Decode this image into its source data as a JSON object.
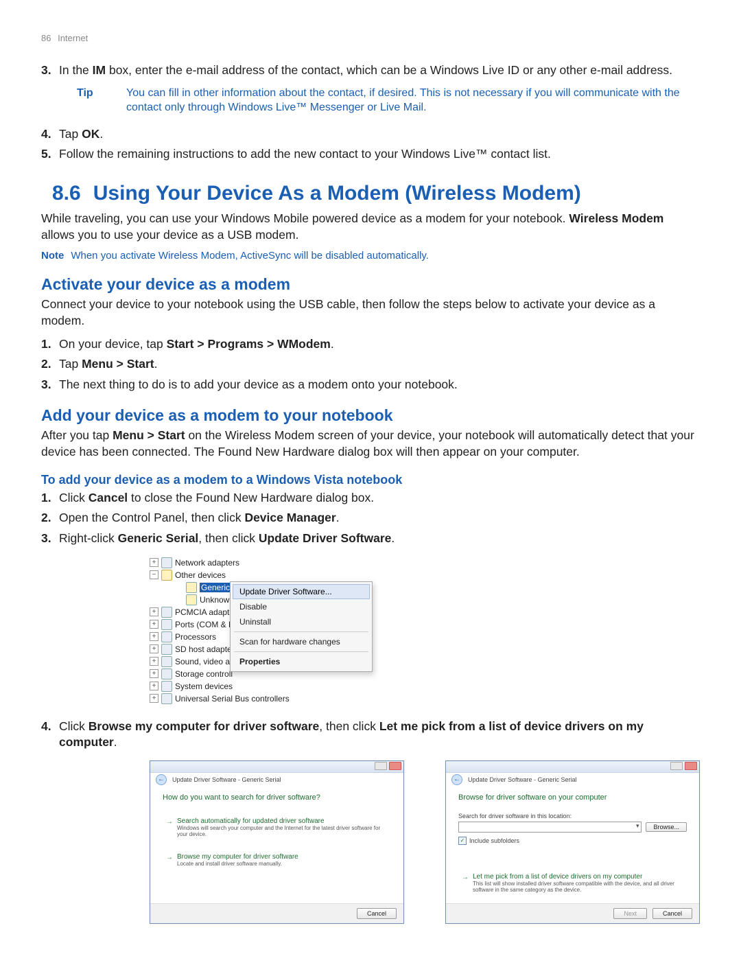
{
  "header": {
    "page_number": "86",
    "section": "Internet"
  },
  "continued_list": {
    "items": [
      {
        "n": "3.",
        "prefix": "In the ",
        "bold1": "IM",
        "suffix": " box, enter the e-mail address of the contact, which can be a Windows Live ID or any other e-mail address."
      },
      {
        "n": "4.",
        "prefix": "Tap ",
        "bold1": "OK",
        "suffix": "."
      },
      {
        "n": "5.",
        "text": "Follow the remaining instructions to add the new contact to your Windows Live™ contact list."
      }
    ],
    "tip": {
      "label": "Tip",
      "body": "You can fill in other information about the contact, if desired. This is not necessary if you will communicate with the contact only through Windows Live™ Messenger or Live Mail."
    }
  },
  "section86": {
    "num": "8.6",
    "title": "Using Your Device As a Modem (Wireless Modem)",
    "intro_pre": "While traveling, you can use your Windows Mobile powered device as a modem for your notebook. ",
    "intro_bold": "Wireless Modem",
    "intro_post": " allows you to use your device as a USB modem.",
    "note_label": "Note",
    "note_body": "When you activate Wireless Modem, ActiveSync will be disabled automatically."
  },
  "activate": {
    "heading": "Activate your device as a modem",
    "intro": "Connect your device to your notebook using the USB cable, then follow the steps below to activate your device as a modem.",
    "steps": [
      {
        "n": "1.",
        "pre": "On your device, tap ",
        "bold": "Start > Programs > WModem",
        "post": "."
      },
      {
        "n": "2.",
        "pre": "Tap ",
        "bold": "Menu > Start",
        "post": "."
      },
      {
        "n": "3.",
        "text": "The next thing to do is to add your device as a modem onto your notebook."
      }
    ]
  },
  "add": {
    "heading": "Add your device as a modem to your notebook",
    "intro_pre": "After you tap ",
    "intro_bold": "Menu > Start",
    "intro_post": " on the Wireless Modem screen of your device, your notebook will automatically detect that your device has been connected. The Found New Hardware dialog box will then appear on your computer.",
    "vista_heading": "To add your device as a modem to a Windows Vista notebook",
    "steps_a": [
      {
        "n": "1.",
        "pre": "Click ",
        "bold": "Cancel",
        "post": " to close the Found New Hardware dialog box."
      },
      {
        "n": "2.",
        "pre": "Open the Control Panel, then click ",
        "bold": "Device Manager",
        "post": "."
      },
      {
        "n": "3.",
        "pre": "Right-click ",
        "bold": "Generic Serial",
        "mid": ", then click ",
        "bold2": "Update Driver Software",
        "post": "."
      }
    ],
    "step4": {
      "n": "4.",
      "pre": "Click ",
      "bold": "Browse my computer for driver software",
      "mid": ", then click ",
      "bold2": "Let me pick from a list of device drivers on my computer",
      "post": "."
    }
  },
  "device_manager": {
    "tree": {
      "network_adapters": "Network adapters",
      "other_devices": "Other devices",
      "generic_serial": "Generic Serial",
      "unknown_device": "Unknown de",
      "pcmcia": "PCMCIA adapte",
      "ports": "Ports (COM & L",
      "processors": "Processors",
      "sd_host": "SD host adapters",
      "sound": "Sound, video an",
      "storage": "Storage controll",
      "system": "System devices",
      "usb": "Universal Serial Bus controllers"
    },
    "menu": {
      "update": "Update Driver Software...",
      "disable": "Disable",
      "uninstall": "Uninstall",
      "scan": "Scan for hardware changes",
      "properties": "Properties"
    }
  },
  "dialog_left": {
    "title": "Update Driver Software - Generic Serial",
    "question": "How do you want to search for driver software?",
    "opt1_title": "Search automatically for updated driver software",
    "opt1_desc": "Windows will search your computer and the Internet for the latest driver software for your device.",
    "opt2_title": "Browse my computer for driver software",
    "opt2_desc": "Locate and install driver software manually.",
    "cancel": "Cancel"
  },
  "dialog_right": {
    "title": "Update Driver Software - Generic Serial",
    "heading": "Browse for driver software on your computer",
    "field_label": "Search for driver software in this location:",
    "browse": "Browse...",
    "include": "Include subfolders",
    "opt_title": "Let me pick from a list of device drivers on my computer",
    "opt_desc": "This list will show installed driver software compatible with the device, and all driver software in the same category as the device.",
    "next": "Next",
    "cancel": "Cancel"
  }
}
